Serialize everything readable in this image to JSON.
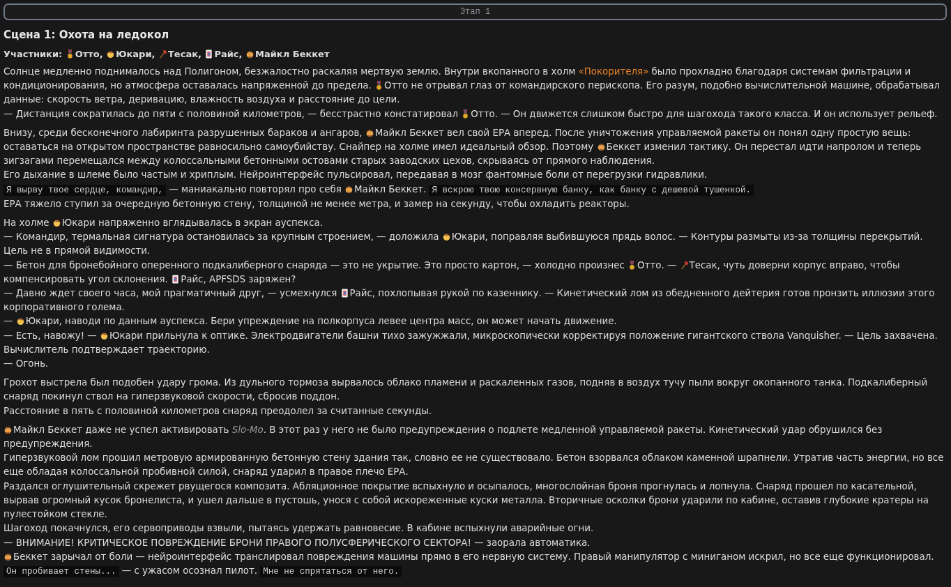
{
  "stage": {
    "label": "Этап 1"
  },
  "title": "Сцена 1: Охота на ледокол",
  "participants": [
    {
      "kind": "text",
      "text": "Участники: "
    },
    {
      "kind": "medal"
    },
    {
      "kind": "text",
      "text": "Отто, "
    },
    {
      "kind": "girl"
    },
    {
      "kind": "text",
      "text": "Юкари, "
    },
    {
      "kind": "axe"
    },
    {
      "kind": "text",
      "text": "Тесак, "
    },
    {
      "kind": "card"
    },
    {
      "kind": "text",
      "text": "Райс, "
    },
    {
      "kind": "man"
    },
    {
      "kind": "text",
      "text": "Майкл Беккет"
    }
  ],
  "paragraphs": [
    {
      "lines": [
        [
          {
            "kind": "text",
            "text": "Солнце медленно поднималось над Полигоном, безжалостно раскаляя мертвую землю. Внутри вкопанного в холм "
          },
          {
            "kind": "link",
            "text": "«Покорителя»"
          },
          {
            "kind": "text",
            "text": " было прохладно благодаря системам фильтрации и кондиционирования, но атмосфера оставалась напряженной до предела. "
          },
          {
            "kind": "medal"
          },
          {
            "kind": "text",
            "text": "Отто не отрывал глаз от командирского перископа. Его разум, подобно вычислительной машине, обрабатывал данные: скорость ветра, деривацию, влажность воздуха и расстояние до цели."
          }
        ],
        [
          {
            "kind": "text",
            "text": "— Дистанция сократилась до пяти с половиной километров, — бесстрастно констатировал "
          },
          {
            "kind": "medal"
          },
          {
            "kind": "text",
            "text": "Отто. — Он движется слишком быстро для шагохода такого класса. И он использует рельеф."
          }
        ]
      ]
    },
    {
      "lines": [
        [
          {
            "kind": "text",
            "text": "Внизу, среди бесконечного лабиринта разрушенных бараков и ангаров, "
          },
          {
            "kind": "man"
          },
          {
            "kind": "text",
            "text": "Майкл Беккет вел свой ЕРА вперед. После уничтожения управляемой ракеты он понял одну простую вещь: оставаться на открытом пространстве равносильно самоубийству. Снайпер на холме имел идеальный обзор. Поэтому "
          },
          {
            "kind": "man"
          },
          {
            "kind": "text",
            "text": "Беккет изменил тактику. Он перестал идти напролом и теперь зигзагами перемещался между колоссальными бетонными остовами старых заводских цехов, скрываясь от прямого наблюдения."
          }
        ],
        [
          {
            "kind": "text",
            "text": "Его дыхание в шлеме было частым и хриплым. Нейроинтерфейс пульсировал, передавая в мозг фантомные боли от перегрузки гидравлики."
          }
        ],
        [
          {
            "kind": "code",
            "text": "Я вырву твое сердце, командир,"
          },
          {
            "kind": "text",
            "text": " — маниакально повторял про себя "
          },
          {
            "kind": "man"
          },
          {
            "kind": "text",
            "text": "Майкл Беккет. "
          },
          {
            "kind": "code",
            "text": "Я вскрою твою консервную банку, как банку с дешевой тушенкой."
          }
        ],
        [
          {
            "kind": "text",
            "text": "ЕРА тяжело ступил за очередную бетонную стену, толщиной не менее метра, и замер на секунду, чтобы охладить реакторы."
          }
        ]
      ]
    },
    {
      "lines": [
        [
          {
            "kind": "text",
            "text": "На холме "
          },
          {
            "kind": "girl"
          },
          {
            "kind": "text",
            "text": "Юкари напряженно вглядывалась в экран ауспекса."
          }
        ],
        [
          {
            "kind": "text",
            "text": "— Командир, термальная сигнатура остановилась за крупным строением, — доложила "
          },
          {
            "kind": "girl"
          },
          {
            "kind": "text",
            "text": "Юкари, поправляя выбившуюся прядь волос. — Контуры размыты из-за толщины перекрытий. Цель не в прямой видимости."
          }
        ],
        [
          {
            "kind": "text",
            "text": "— Бетон для бронебойного оперенного подкалиберного снаряда — это не укрытие. Это просто картон, — холодно произнес "
          },
          {
            "kind": "medal"
          },
          {
            "kind": "text",
            "text": "Отто. — "
          },
          {
            "kind": "axe"
          },
          {
            "kind": "text",
            "text": "Тесак, чуть доверни корпус вправо, чтобы компенсировать угол склонения. "
          },
          {
            "kind": "card"
          },
          {
            "kind": "text",
            "text": "Райс, APFSDS заряжен?"
          }
        ],
        [
          {
            "kind": "text",
            "text": "— Давно ждет своего часа, мой прагматичный друг, — усмехнулся "
          },
          {
            "kind": "card"
          },
          {
            "kind": "text",
            "text": "Райс, похлопывая рукой по казеннику. — Кинетический лом из обедненного дейтерия готов пронзить иллюзии этого корпоративного голема."
          }
        ],
        [
          {
            "kind": "text",
            "text": "— "
          },
          {
            "kind": "girl"
          },
          {
            "kind": "text",
            "text": "Юкари, наводи по данным ауспекса. Бери упреждение на полкорпуса левее центра масс, он может начать движение."
          }
        ],
        [
          {
            "kind": "text",
            "text": "— Есть, навожу! — "
          },
          {
            "kind": "girl"
          },
          {
            "kind": "text",
            "text": "Юкари прильнула к оптике. Электродвигатели башни тихо зажужжали, микроскопически корректируя положение гигантского ствола Vanquisher. — Цель захвачена. Вычислитель подтверждает траекторию."
          }
        ],
        [
          {
            "kind": "text",
            "text": "— Огонь."
          }
        ]
      ]
    },
    {
      "lines": [
        [
          {
            "kind": "text",
            "text": "Грохот выстрела был подобен удару грома. Из дульного тормоза вырвалось облако пламени и раскаленных газов, подняв в воздух тучу пыли вокруг окопанного танка. Подкалиберный снаряд покинул ствол на гиперзвуковой скорости, сбросив поддон."
          }
        ],
        [
          {
            "kind": "text",
            "text": "Расстояние в пять с половиной километров снаряд преодолел за считанные секунды."
          }
        ]
      ]
    },
    {
      "lines": [
        [
          {
            "kind": "man"
          },
          {
            "kind": "text",
            "text": "Майкл Беккет даже не успел активировать "
          },
          {
            "kind": "em",
            "text": "Slo-Mo"
          },
          {
            "kind": "text",
            "text": ". В этот раз у него не было предупреждения о подлете медленной управляемой ракеты. Кинетический удар обрушился без предупреждения."
          }
        ],
        [
          {
            "kind": "text",
            "text": "Гиперзвуковой лом прошил метровую армированную бетонную стену здания так, словно ее не существовало. Бетон взорвался облаком каменной шрапнели. Утратив часть энергии, но все еще обладая колоссальной пробивной силой, снаряд ударил в правое плечо ЕРА."
          }
        ],
        [
          {
            "kind": "text",
            "text": "Раздался оглушительный скрежет рвущегося композита. Абляционное покрытие вспыхнуло и осыпалось, многослойная броня прогнулась и лопнула. Снаряд прошел по касательной, вырвав огромный кусок бронелиста, и ушел дальше в пустошь, унося с собой искореженные куски металла. Вторичные осколки брони ударили по кабине, оставив глубокие кратеры на пулестойком стекле."
          }
        ],
        [
          {
            "kind": "text",
            "text": "Шагоход покачнулся, его сервоприводы взвыли, пытаясь удержать равновесие. В кабине вспыхнули аварийные огни."
          }
        ],
        [
          {
            "kind": "text",
            "text": "— ВНИМАНИЕ! КРИТИЧЕСКОЕ ПОВРЕЖДЕНИЕ БРОНИ ПРАВОГО ПОЛУСФЕРИЧЕСКОГО СЕКТОРА! — заорала автоматика."
          }
        ],
        [
          {
            "kind": "man"
          },
          {
            "kind": "text",
            "text": "Беккет зарычал от боли — нейроинтерфейс транслировал повреждения машины прямо в его нервную систему. Правый манипулятор с миниганом искрил, но все еще функционировал."
          }
        ],
        [
          {
            "kind": "code",
            "text": "Он пробивает стены..."
          },
          {
            "kind": "text",
            "text": " — с ужасом осознал пилот. "
          },
          {
            "kind": "code",
            "text": "Мне не спрятаться от него."
          }
        ]
      ]
    }
  ]
}
